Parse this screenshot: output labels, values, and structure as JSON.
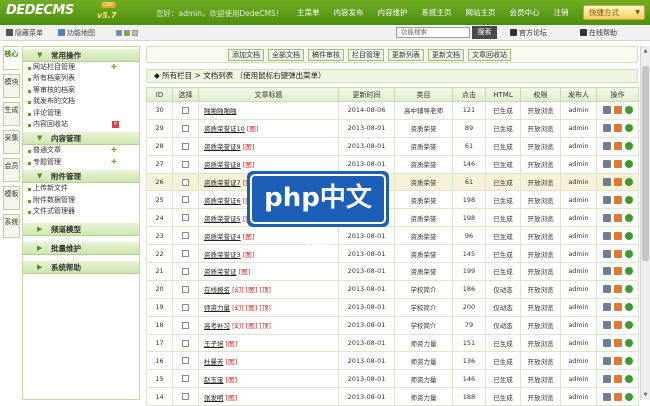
{
  "header": {
    "logo": "DEDECMS",
    "version": "v5.7",
    "badge": "GBK",
    "welcome": "您好：admin，欢迎使用DedeCMS！",
    "nav": [
      "主菜单",
      "内容发布",
      "内容维护",
      "系统主页",
      "网站主页",
      "会员中心",
      "注销"
    ],
    "quick": "快捷方式"
  },
  "subbar": {
    "hide_menu": "隐藏菜单",
    "map": "功能地图",
    "search_placeholder": "功能搜索",
    "search_btn": "搜索",
    "forum": "官方论坛",
    "help": "在线帮助"
  },
  "vtabs": [
    "核心",
    "模块",
    "生成",
    "采集",
    "会员",
    "模板",
    "系统"
  ],
  "menu": {
    "sections": [
      {
        "title": "常用操作",
        "items": [
          "网站栏目管理",
          "所有档案列表",
          "等审核的档案",
          "我发布的文档",
          "评论管理",
          "内容回收站"
        ]
      },
      {
        "title": "内容管理",
        "items": [
          "普通文章",
          "专题管理"
        ]
      },
      {
        "title": "附件管理",
        "items": [
          "上传新文件",
          "附件数据管理",
          "文件式管理器"
        ]
      },
      {
        "title": "频道模型",
        "items": []
      },
      {
        "title": "批量维护",
        "items": []
      },
      {
        "title": "系统帮助",
        "items": []
      }
    ]
  },
  "toolbar": {
    "buttons": [
      "添加文档",
      "全部文档",
      "稿件审核",
      "栏目管理",
      "更新列表",
      "更新文档",
      "文章回收站"
    ]
  },
  "breadcrumb": "所有栏目 > 文档列表  （使用鼠标右键弹出菜单）",
  "table": {
    "headers": [
      "ID",
      "选择",
      "文章标题",
      "更新时间",
      "类目",
      "点击",
      "HTML",
      "权限",
      "发布人",
      "操作"
    ],
    "rows": [
      {
        "id": "30",
        "title": "啪啪啪啪啪",
        "tag": "",
        "time": "2014-08-06",
        "cat": "高中辅导老师",
        "hits": "121",
        "html": "已生成",
        "perm": "开放浏览",
        "user": "admin"
      },
      {
        "id": "29",
        "title": "资质荣誉证10",
        "tag": "[图]",
        "time": "2013-08-01",
        "cat": "资质荣誉",
        "hits": "89",
        "html": "已生成",
        "perm": "开放浏览",
        "user": "admin"
      },
      {
        "id": "28",
        "title": "资质荣誉证9",
        "tag": "[图]",
        "time": "2013-08-01",
        "cat": "资质荣誉",
        "hits": "61",
        "html": "已生成",
        "perm": "开放浏览",
        "user": "admin"
      },
      {
        "id": "27",
        "title": "资质荣誉证8",
        "tag": "[图]",
        "time": "2013-08-01",
        "cat": "资质荣誉",
        "hits": "146",
        "html": "已生成",
        "perm": "开放浏览",
        "user": "admin"
      },
      {
        "id": "26",
        "title": "资质荣誉证7",
        "tag": "[图]",
        "time": "2013-08-01",
        "cat": "资质荣誉",
        "hits": "61",
        "html": "已生成",
        "perm": "开放浏览",
        "user": "admin"
      },
      {
        "id": "25",
        "title": "资质荣誉证6",
        "tag": "[图]",
        "time": "2013-08-01",
        "cat": "资质荣誉",
        "hits": "198",
        "html": "已生成",
        "perm": "开放浏览",
        "user": "admin"
      },
      {
        "id": "24",
        "title": "资质荣誉证5",
        "tag": "[图]",
        "time": "2013-08-01",
        "cat": "资质荣誉",
        "hits": "198",
        "html": "已生成",
        "perm": "开放浏览",
        "user": "admin"
      },
      {
        "id": "23",
        "title": "资质荣誉证4",
        "tag": "[图]",
        "time": "2013-08-01",
        "cat": "资质荣誉",
        "hits": "96",
        "html": "已生成",
        "perm": "开放浏览",
        "user": "admin"
      },
      {
        "id": "22",
        "title": "资质荣誉证3",
        "tag": "[图]",
        "time": "2013-08-01",
        "cat": "资质荣誉",
        "hits": "145",
        "html": "已生成",
        "perm": "开放浏览",
        "user": "admin"
      },
      {
        "id": "21",
        "title": "资质荣誉证",
        "tag": "[图]",
        "time": "2013-08-01",
        "cat": "资质荣誉",
        "hits": "199",
        "html": "已生成",
        "perm": "开放浏览",
        "user": "admin"
      },
      {
        "id": "20",
        "title": "在线报名",
        "tag": "[幻] [图] [顶]",
        "time": "2013-08-01",
        "cat": "学校简介",
        "hits": "186",
        "html": "仅动态",
        "perm": "开放浏览",
        "user": "admin"
      },
      {
        "id": "19",
        "title": "师资力量",
        "tag": "[幻] [图] [顶]",
        "time": "2013-08-01",
        "cat": "学校简介",
        "hits": "200",
        "html": "仅动态",
        "perm": "开放浏览",
        "user": "admin"
      },
      {
        "id": "18",
        "title": "高考补习",
        "tag": "[幻] [图] [顶]",
        "time": "2013-08-01",
        "cat": "学校简介",
        "hits": "79",
        "html": "仅动态",
        "perm": "开放浏览",
        "user": "admin"
      },
      {
        "id": "17",
        "title": "王子培",
        "tag": "[图]",
        "time": "2013-08-01",
        "cat": "师资力量",
        "hits": "151",
        "html": "已生成",
        "perm": "开放浏览",
        "user": "admin"
      },
      {
        "id": "16",
        "title": "杜曼芳",
        "tag": "[图]",
        "time": "2013-08-01",
        "cat": "师资力量",
        "hits": "136",
        "html": "已生成",
        "perm": "开放浏览",
        "user": "admin"
      },
      {
        "id": "15",
        "title": "赵玉宝",
        "tag": "[图]",
        "time": "2013-08-01",
        "cat": "师资力量",
        "hits": "146",
        "html": "已生成",
        "perm": "开放浏览",
        "user": "admin"
      },
      {
        "id": "14",
        "title": "张发明",
        "tag": "[图]",
        "time": "2013-08-01",
        "cat": "师资力量",
        "hits": "188",
        "html": "已生成",
        "perm": "开放浏览",
        "user": "admin"
      }
    ],
    "highlight_id": "26"
  },
  "watermark": "php中文网"
}
